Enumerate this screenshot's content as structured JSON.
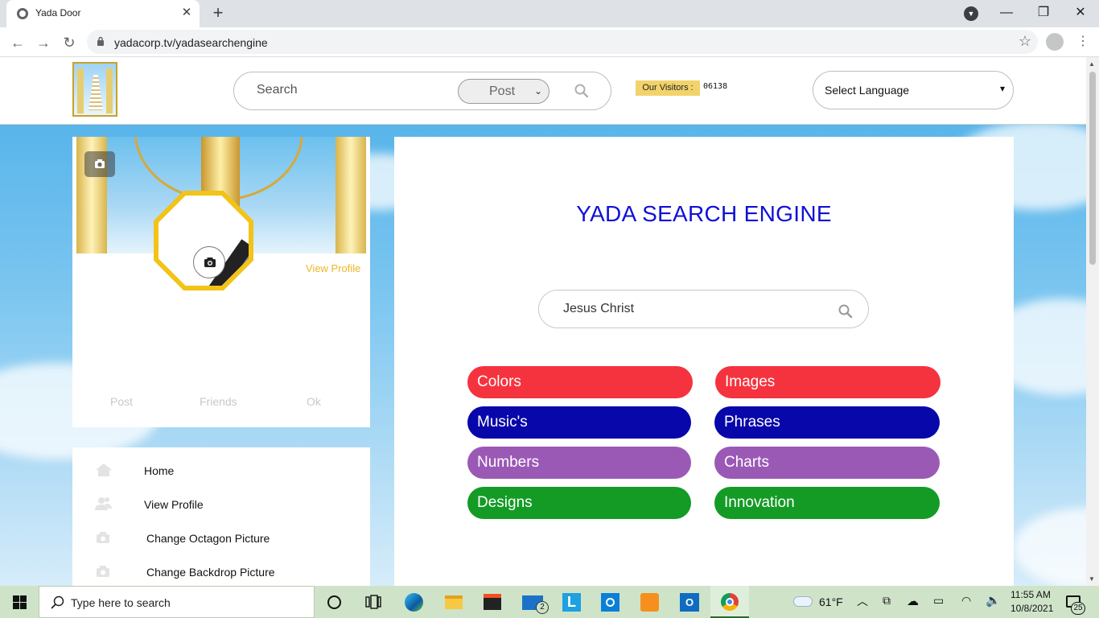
{
  "browser": {
    "tab_title": "Yada Door",
    "tab_close": "✕",
    "new_tab": "+",
    "url": "yadacorp.tv/yadasearchengine",
    "controls": {
      "minimize": "—",
      "restore": "❐",
      "close": "✕"
    }
  },
  "header": {
    "search_placeholder": "Search",
    "search_type_selected": "Post",
    "visitors_label": "Our Visitors :",
    "visitors_count": "06138",
    "language_selected": "Select Language"
  },
  "profile": {
    "view_profile": "View Profile",
    "stats": [
      "Post",
      "Friends",
      "Ok"
    ]
  },
  "menu": {
    "items": [
      {
        "label": "Home",
        "icon": "home-icon"
      },
      {
        "label": "View Profile",
        "icon": "users-icon"
      },
      {
        "label": "Change Octagon Picture",
        "icon": "camera-icon"
      },
      {
        "label": "Change Backdrop Picture",
        "icon": "camera-icon"
      }
    ]
  },
  "main": {
    "title": "YADA SEARCH ENGINE",
    "search_value": "Jesus Christ",
    "categories": [
      {
        "label": "Colors",
        "color": "#f5333f"
      },
      {
        "label": "Images",
        "color": "#f5333f"
      },
      {
        "label": "Music's",
        "color": "#0707aa"
      },
      {
        "label": "Phrases",
        "color": "#0707aa"
      },
      {
        "label": "Numbers",
        "color": "#9b59b6"
      },
      {
        "label": "Charts",
        "color": "#9b59b6"
      },
      {
        "label": "Designs",
        "color": "#139b26"
      },
      {
        "label": "Innovation",
        "color": "#139b26"
      }
    ]
  },
  "taskbar": {
    "search_placeholder": "Type here to search",
    "weather": "61°F",
    "time": "11:55 AM",
    "date": "10/8/2021",
    "mail_badge": "2",
    "notifications_badge": "25"
  }
}
